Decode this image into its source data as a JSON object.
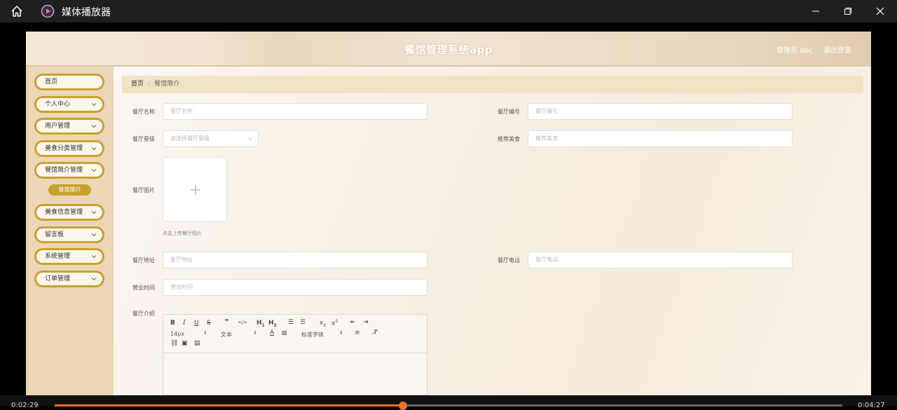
{
  "window": {
    "title": "媒体播放器",
    "home_icon": "home-icon",
    "app_icon": "media-player-icon"
  },
  "header": {
    "title": "餐馆管理系统app",
    "user": "管理员 abc",
    "logout": "退出登录"
  },
  "sidebar": {
    "items": [
      {
        "label": "首页"
      },
      {
        "label": "个人中心"
      },
      {
        "label": "用户管理"
      },
      {
        "label": "美食分类管理"
      },
      {
        "label": "餐馆简介管理"
      },
      {
        "label": "美食信息管理"
      },
      {
        "label": "留言板"
      },
      {
        "label": "系统管理"
      },
      {
        "label": "订单管理"
      }
    ],
    "active_sub": "餐馆简介"
  },
  "breadcrumb": {
    "home": "首页",
    "separator": "/",
    "current": "餐馆简介"
  },
  "form": {
    "name_label": "餐厅名称",
    "name_placeholder": "餐厅名称",
    "code_label": "餐厅编号",
    "code_placeholder": "餐厅编号",
    "star_label": "餐厅星级",
    "star_placeholder": "请选择餐厅星级",
    "recommend_label": "推荐美食",
    "recommend_placeholder": "推荐美食",
    "image_label": "餐厅图片",
    "upload_hint": "点击上传餐厅图片",
    "address_label": "餐厅地址",
    "address_placeholder": "餐厅地址",
    "phone_label": "餐厅电话",
    "phone_placeholder": "餐厅电话",
    "hours_label": "营业时间",
    "hours_placeholder": "营业时间",
    "intro_label": "餐厅介绍"
  },
  "editor": {
    "size": "14px",
    "format": "文本",
    "font": "标准字体"
  },
  "player": {
    "time_elapsed": "0:02:29",
    "time_total": "0:04:27",
    "progress": 0.442,
    "accent": "#e8742b"
  }
}
